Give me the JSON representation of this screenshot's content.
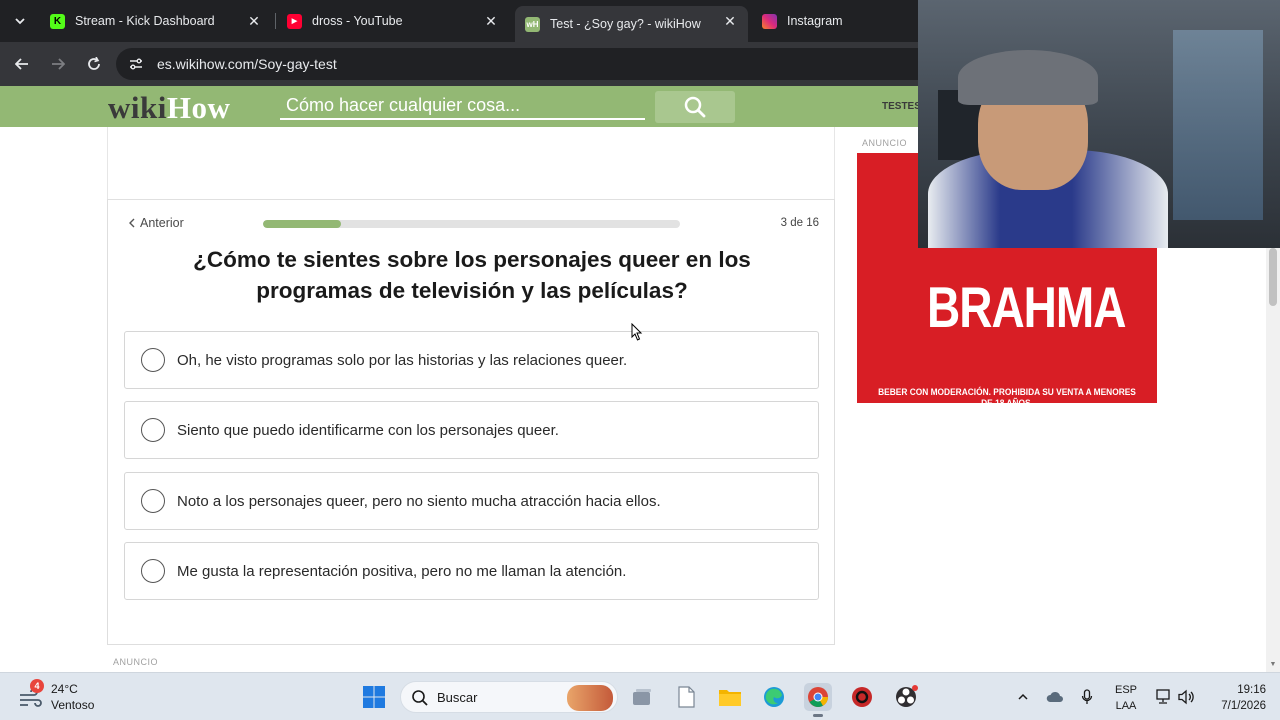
{
  "browser": {
    "tabs": [
      {
        "title": "Stream - Kick Dashboard",
        "favicon": "kick-icon",
        "active": false
      },
      {
        "title": "dross - YouTube",
        "favicon": "youtube-icon",
        "active": false
      },
      {
        "title": "Test - ¿Soy gay? - wikiHow",
        "favicon": "wikihow-icon",
        "active": true
      },
      {
        "title": "Instagram",
        "favicon": "instagram-icon",
        "active": false
      }
    ],
    "url": "es.wikihow.com/Soy-gay-test"
  },
  "header": {
    "logo_part1": "wiki",
    "logo_part2": "How",
    "search_placeholder": "Cómo hacer cualquier cosa...",
    "nav_item": "TESTES",
    "brand_color": "#93b874"
  },
  "quiz": {
    "prev_label": "Anterior",
    "step_text": "3 de 16",
    "progress_fraction": 0.1875,
    "question": "¿Cómo te sientes sobre los personajes queer en los programas de televisión y las películas?",
    "answers": [
      "Oh, he visto programas solo por las historias y las relaciones queer.",
      "Siento que puedo identificarme con los personajes queer.",
      "Noto a los personajes queer, pero no siento mucha atracción hacia ellos.",
      "Me gusta la representación positiva, pero no me llaman la atención."
    ]
  },
  "ads": {
    "label_right": "ANUNCIO",
    "label_bottom": "ANUNCIO",
    "brand": "BRAHMA",
    "disclaimer": "BEBER CON MODERACIÓN. PROHIBIDA SU VENTA A MENORES DE 18 AÑOS."
  },
  "taskbar": {
    "weather_temp": "24°C",
    "weather_condition": "Ventoso",
    "weather_badge": "4",
    "search_label": "Buscar",
    "lang_line1": "ESP",
    "lang_line2": "LAA",
    "time": "19:16",
    "date": "7/1/2026"
  }
}
